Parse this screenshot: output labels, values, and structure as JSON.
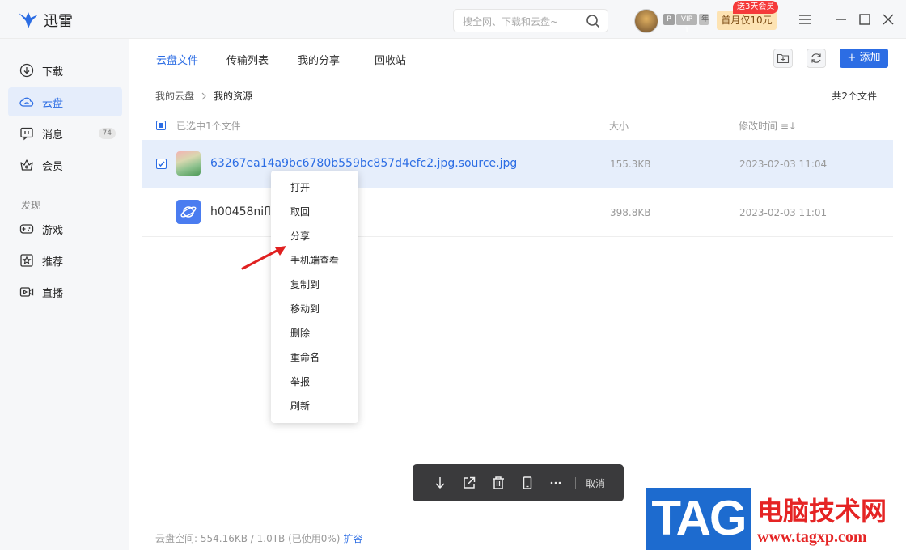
{
  "app": {
    "name": "迅雷"
  },
  "search": {
    "placeholder": "搜全网、下载和云盘~"
  },
  "user": {
    "badge_p": "P",
    "badge_vip": "VIP 1",
    "badge_year": "年",
    "promo_tag": "送3天会员",
    "promo": "首月仅10元"
  },
  "sidebar": {
    "items": [
      {
        "label": "下载",
        "icon": "download-icon"
      },
      {
        "label": "云盘",
        "icon": "cloud-icon"
      },
      {
        "label": "消息",
        "icon": "message-icon",
        "count": "74"
      },
      {
        "label": "会员",
        "icon": "crown-icon"
      }
    ],
    "section": "发现",
    "discover": [
      {
        "label": "游戏",
        "icon": "gamepad-icon"
      },
      {
        "label": "推荐",
        "icon": "star-icon"
      },
      {
        "label": "直播",
        "icon": "live-icon"
      }
    ]
  },
  "tabs": [
    "云盘文件",
    "传输列表",
    "我的分享",
    "回收站"
  ],
  "toolbar": {
    "add_label": "添加"
  },
  "breadcrumb": {
    "root": "我的云盘",
    "current": "我的资源"
  },
  "file_count": "共2个文件",
  "list_header": {
    "selected": "已选中1个文件",
    "size": "大小",
    "modified": "修改时间 ≡↓"
  },
  "files": [
    {
      "name": "63267ea14a9bc6780b559bc857d4efc2.jpg.source.jpg",
      "size": "155.3KB",
      "date": "2023-02-03 11:04",
      "selected": true
    },
    {
      "name": "h00458nifli.l",
      "size": "398.8KB",
      "date": "2023-02-03 11:01",
      "selected": false
    }
  ],
  "context_menu": [
    "打开",
    "取回",
    "分享",
    "手机端查看",
    "复制到",
    "移动到",
    "删除",
    "重命名",
    "举报",
    "刷新"
  ],
  "action_bar": {
    "cancel": "取消"
  },
  "storage": {
    "label": "云盘空间: 554.16KB / 1.0TB (已使用0%)",
    "expand": "扩容"
  },
  "watermark": {
    "tag": "TAG",
    "cn": "电脑技术网",
    "url": "www.tagxp.com"
  },
  "colors": {
    "accent": "#2c6de4",
    "arrow": "#e02020"
  }
}
